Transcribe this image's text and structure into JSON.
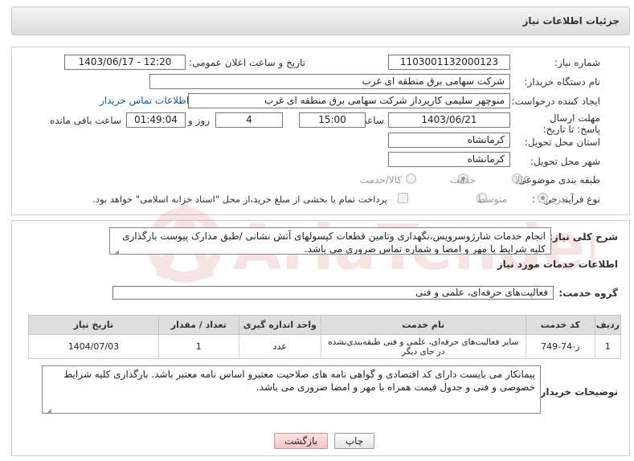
{
  "header": {
    "title": "جزئیات اطلاعات نیاز"
  },
  "fields": {
    "need_number": {
      "label": "شماره نیاز:",
      "value": "1103001132000123"
    },
    "announce_datetime": {
      "label": "تاریخ و ساعت اعلان عمومی:",
      "value": "1403/06/17 - 12:20"
    },
    "buyer_org": {
      "label": "نام دستگاه خریدار:",
      "value": "شرکت سهامی برق منطقه ای غرب"
    },
    "requester": {
      "label": "ایجاد کننده درخواست:",
      "value": "منوچهر  سلیمی کارپرداز شرکت سهامی برق منطقه ای غرب",
      "link": "اطلاعات تماس خریدار"
    },
    "deadline": {
      "label": "مهلت ارسال پاسخ: تا تاریخ:",
      "date": "1403/06/21",
      "time_label": "ساعت",
      "time": "15:00",
      "days": "4",
      "days_label": "روز و",
      "remaining": "01:49:04",
      "remaining_label": "ساعت باقی مانده"
    },
    "province": {
      "label": "استان محل تحویل:",
      "value": "کرمانشاه"
    },
    "city": {
      "label": "شهر محل تحویل:",
      "value": "کرمانشاه"
    },
    "category": {
      "label": "طبقه بندی موضوعی:",
      "options": [
        "کالا",
        "خدمت",
        "کالا/خدمت"
      ],
      "selected": "خدمت"
    },
    "process_type": {
      "label": "نوع فرآیند خرید :",
      "options": [
        "جزیی",
        "متوسط"
      ],
      "selected": "جزیی",
      "payment_note": "پرداخت تمام یا بخشی از مبلغ خرید،از محل \"اسناد خزانه اسلامی\" خواهد بود."
    }
  },
  "summary": {
    "label": "شرح کلی نیاز:",
    "text": "انجام خدمات شارژوسرویس،نگهداری وتامین قطعات کپسولهای آتش نشانی /طبق مدارک پیوست بارگذاری کلیه شرایط  با مهر و امضا و شماره تماس ضروری می باشد."
  },
  "services_info": {
    "title": "اطلاعات خدمات مورد نیاز",
    "group_label": "گروه خدمت:",
    "group_value": "فعالیت‌های حرفه‌ای، علمی و فنی"
  },
  "table": {
    "headers": [
      "ردیف",
      "کد خدمت",
      "نام خدمت",
      "واحد اندازه گیری",
      "تعداد / مقدار",
      "تاریخ نیاز"
    ],
    "rows": [
      [
        "1",
        "ز-74-749",
        "سایر فعالیت‌های حرفه‌ای، علمی و فنی طبقه‌بندی‌نشده در جای دیگر",
        "عدد",
        "1",
        "1404/07/03"
      ]
    ]
  },
  "buyer_notes": {
    "label": "توضیحات خریدار:",
    "text": "پیمانکار می بایست دارای کد اقتصادی و گواهی نامه های صلاحیت معتبرو اساس نامه معتبر  باشد. بارگذاری کلیه شرایط خصوصی و فنی و جدول قیمت همراه با مهر و امضا ضروری می باشد."
  },
  "buttons": {
    "print": "چاپ",
    "back": "بازگشت"
  },
  "colors": {
    "link": "#1a58b0",
    "header_bg": "#dcdcdc",
    "back_button": "#f3c6c6"
  }
}
